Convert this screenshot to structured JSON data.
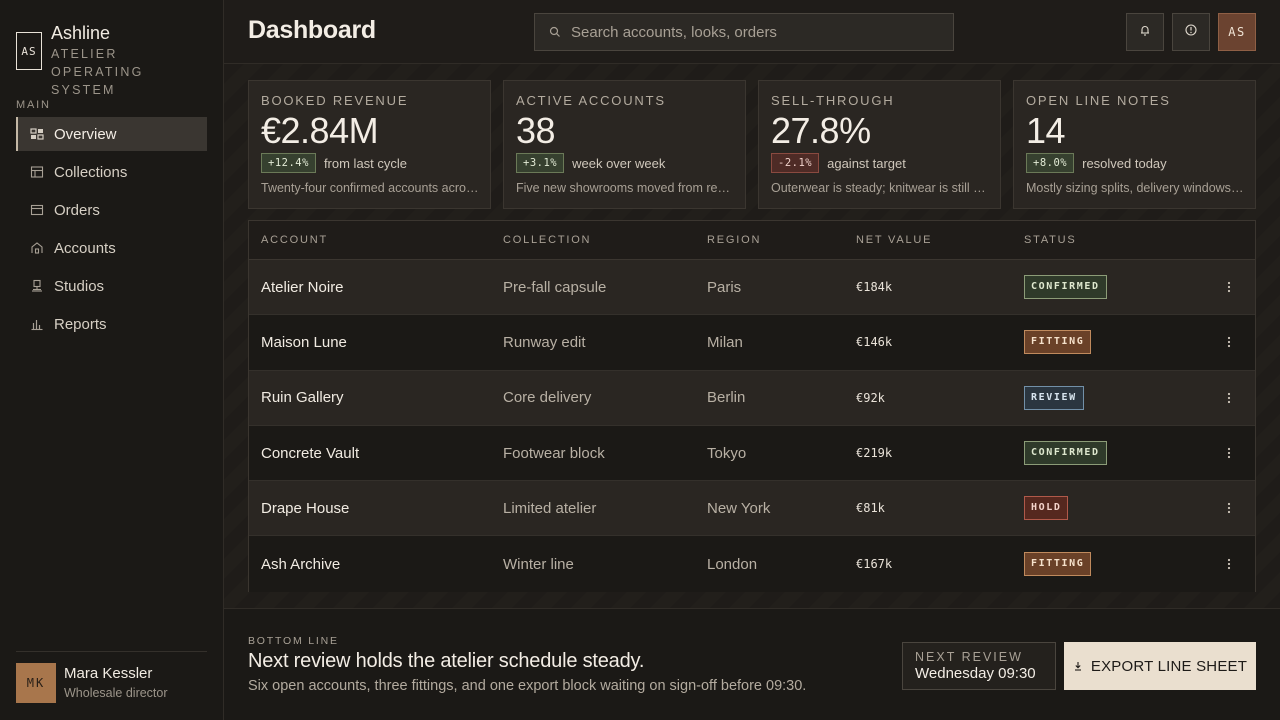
{
  "brand": {
    "mark": "AS",
    "name": "Ashline",
    "subtitle": "ATELIER OPERATING SYSTEM"
  },
  "sidebar": {
    "section_label": "MAIN",
    "items": [
      {
        "label": "Overview",
        "icon": "grid-icon",
        "active": true
      },
      {
        "label": "Collections",
        "icon": "layers-icon",
        "active": false
      },
      {
        "label": "Orders",
        "icon": "box-icon",
        "active": false
      },
      {
        "label": "Accounts",
        "icon": "store-icon",
        "active": false
      },
      {
        "label": "Studios",
        "icon": "studio-icon",
        "active": false
      },
      {
        "label": "Reports",
        "icon": "bar-chart-icon",
        "active": false
      }
    ],
    "user": {
      "initials": "MK",
      "name": "Mara Kessler",
      "role": "Wholesale director"
    }
  },
  "header": {
    "title": "Dashboard",
    "search_placeholder": "Search accounts, looks, orders",
    "search_value": "",
    "avatar_initials": "AS"
  },
  "kpis": [
    {
      "label": "BOOKED REVENUE",
      "value": "€2.84M",
      "delta": "+12.4%",
      "direction": "up",
      "context": "from last cycle",
      "note": "Twenty-four confirmed accounts across the current cycle"
    },
    {
      "label": "ACTIVE ACCOUNTS",
      "value": "38",
      "delta": "+3.1%",
      "direction": "up",
      "context": "week over week",
      "note": "Five new showrooms moved from review to confirmed"
    },
    {
      "label": "SELL-THROUGH",
      "value": "27.8%",
      "delta": "-2.1%",
      "direction": "down",
      "context": "against target",
      "note": "Outerwear is steady; knitwear is still trailing forecast"
    },
    {
      "label": "OPEN LINE NOTES",
      "value": "14",
      "delta": "+8.0%",
      "direction": "up",
      "context": "resolved today",
      "note": "Mostly sizing splits, delivery windows and fabric swaps"
    }
  ],
  "table": {
    "headers": {
      "account": "ACCOUNT",
      "collection": "COLLECTION",
      "region": "REGION",
      "net_value": "NET VALUE",
      "status": "STATUS"
    },
    "rows": [
      {
        "account": "Atelier Noire",
        "collection": "Pre-fall capsule",
        "region": "Paris",
        "net_value": "€184k",
        "status": "CONFIRMED",
        "status_key": "confirmed"
      },
      {
        "account": "Maison Lune",
        "collection": "Runway edit",
        "region": "Milan",
        "net_value": "€146k",
        "status": "FITTING",
        "status_key": "fitting"
      },
      {
        "account": "Ruin Gallery",
        "collection": "Core delivery",
        "region": "Berlin",
        "net_value": "€92k",
        "status": "REVIEW",
        "status_key": "review"
      },
      {
        "account": "Concrete Vault",
        "collection": "Footwear block",
        "region": "Tokyo",
        "net_value": "€219k",
        "status": "CONFIRMED",
        "status_key": "confirmed"
      },
      {
        "account": "Drape House",
        "collection": "Limited atelier",
        "region": "New York",
        "net_value": "€81k",
        "status": "HOLD",
        "status_key": "hold"
      },
      {
        "account": "Ash Archive",
        "collection": "Winter line",
        "region": "London",
        "net_value": "€167k",
        "status": "FITTING",
        "status_key": "fitting"
      }
    ]
  },
  "footer": {
    "eyebrow": "BOTTOM LINE",
    "title": "Next review holds the atelier schedule steady.",
    "subtitle": "Six open accounts, three fittings, and one export block waiting on sign-off before 09:30.",
    "next_review_label": "NEXT REVIEW",
    "next_review_value": "Wednesday 09:30",
    "export_label": "EXPORT LINE SHEET"
  },
  "colors": {
    "background": "#1e1b18",
    "accent": "#a8764c",
    "confirmed": "#8c9c78",
    "fitting": "#c08a5d",
    "review": "#7290a8",
    "hold": "#b0594a"
  }
}
